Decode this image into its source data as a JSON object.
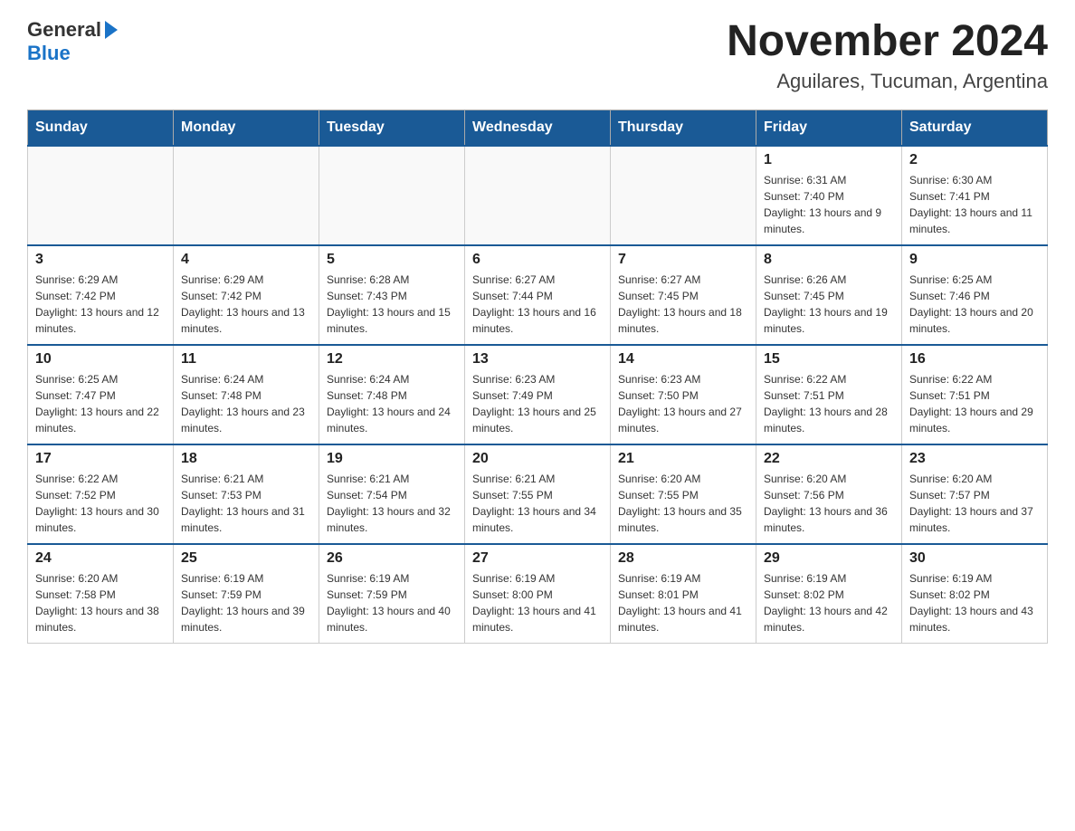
{
  "header": {
    "logo_text": "General",
    "logo_blue": "Blue",
    "title": "November 2024",
    "subtitle": "Aguilares, Tucuman, Argentina"
  },
  "days_of_week": [
    "Sunday",
    "Monday",
    "Tuesday",
    "Wednesday",
    "Thursday",
    "Friday",
    "Saturday"
  ],
  "weeks": [
    {
      "days": [
        {
          "num": "",
          "info": ""
        },
        {
          "num": "",
          "info": ""
        },
        {
          "num": "",
          "info": ""
        },
        {
          "num": "",
          "info": ""
        },
        {
          "num": "",
          "info": ""
        },
        {
          "num": "1",
          "info": "Sunrise: 6:31 AM\nSunset: 7:40 PM\nDaylight: 13 hours and 9 minutes."
        },
        {
          "num": "2",
          "info": "Sunrise: 6:30 AM\nSunset: 7:41 PM\nDaylight: 13 hours and 11 minutes."
        }
      ]
    },
    {
      "days": [
        {
          "num": "3",
          "info": "Sunrise: 6:29 AM\nSunset: 7:42 PM\nDaylight: 13 hours and 12 minutes."
        },
        {
          "num": "4",
          "info": "Sunrise: 6:29 AM\nSunset: 7:42 PM\nDaylight: 13 hours and 13 minutes."
        },
        {
          "num": "5",
          "info": "Sunrise: 6:28 AM\nSunset: 7:43 PM\nDaylight: 13 hours and 15 minutes."
        },
        {
          "num": "6",
          "info": "Sunrise: 6:27 AM\nSunset: 7:44 PM\nDaylight: 13 hours and 16 minutes."
        },
        {
          "num": "7",
          "info": "Sunrise: 6:27 AM\nSunset: 7:45 PM\nDaylight: 13 hours and 18 minutes."
        },
        {
          "num": "8",
          "info": "Sunrise: 6:26 AM\nSunset: 7:45 PM\nDaylight: 13 hours and 19 minutes."
        },
        {
          "num": "9",
          "info": "Sunrise: 6:25 AM\nSunset: 7:46 PM\nDaylight: 13 hours and 20 minutes."
        }
      ]
    },
    {
      "days": [
        {
          "num": "10",
          "info": "Sunrise: 6:25 AM\nSunset: 7:47 PM\nDaylight: 13 hours and 22 minutes."
        },
        {
          "num": "11",
          "info": "Sunrise: 6:24 AM\nSunset: 7:48 PM\nDaylight: 13 hours and 23 minutes."
        },
        {
          "num": "12",
          "info": "Sunrise: 6:24 AM\nSunset: 7:48 PM\nDaylight: 13 hours and 24 minutes."
        },
        {
          "num": "13",
          "info": "Sunrise: 6:23 AM\nSunset: 7:49 PM\nDaylight: 13 hours and 25 minutes."
        },
        {
          "num": "14",
          "info": "Sunrise: 6:23 AM\nSunset: 7:50 PM\nDaylight: 13 hours and 27 minutes."
        },
        {
          "num": "15",
          "info": "Sunrise: 6:22 AM\nSunset: 7:51 PM\nDaylight: 13 hours and 28 minutes."
        },
        {
          "num": "16",
          "info": "Sunrise: 6:22 AM\nSunset: 7:51 PM\nDaylight: 13 hours and 29 minutes."
        }
      ]
    },
    {
      "days": [
        {
          "num": "17",
          "info": "Sunrise: 6:22 AM\nSunset: 7:52 PM\nDaylight: 13 hours and 30 minutes."
        },
        {
          "num": "18",
          "info": "Sunrise: 6:21 AM\nSunset: 7:53 PM\nDaylight: 13 hours and 31 minutes."
        },
        {
          "num": "19",
          "info": "Sunrise: 6:21 AM\nSunset: 7:54 PM\nDaylight: 13 hours and 32 minutes."
        },
        {
          "num": "20",
          "info": "Sunrise: 6:21 AM\nSunset: 7:55 PM\nDaylight: 13 hours and 34 minutes."
        },
        {
          "num": "21",
          "info": "Sunrise: 6:20 AM\nSunset: 7:55 PM\nDaylight: 13 hours and 35 minutes."
        },
        {
          "num": "22",
          "info": "Sunrise: 6:20 AM\nSunset: 7:56 PM\nDaylight: 13 hours and 36 minutes."
        },
        {
          "num": "23",
          "info": "Sunrise: 6:20 AM\nSunset: 7:57 PM\nDaylight: 13 hours and 37 minutes."
        }
      ]
    },
    {
      "days": [
        {
          "num": "24",
          "info": "Sunrise: 6:20 AM\nSunset: 7:58 PM\nDaylight: 13 hours and 38 minutes."
        },
        {
          "num": "25",
          "info": "Sunrise: 6:19 AM\nSunset: 7:59 PM\nDaylight: 13 hours and 39 minutes."
        },
        {
          "num": "26",
          "info": "Sunrise: 6:19 AM\nSunset: 7:59 PM\nDaylight: 13 hours and 40 minutes."
        },
        {
          "num": "27",
          "info": "Sunrise: 6:19 AM\nSunset: 8:00 PM\nDaylight: 13 hours and 41 minutes."
        },
        {
          "num": "28",
          "info": "Sunrise: 6:19 AM\nSunset: 8:01 PM\nDaylight: 13 hours and 41 minutes."
        },
        {
          "num": "29",
          "info": "Sunrise: 6:19 AM\nSunset: 8:02 PM\nDaylight: 13 hours and 42 minutes."
        },
        {
          "num": "30",
          "info": "Sunrise: 6:19 AM\nSunset: 8:02 PM\nDaylight: 13 hours and 43 minutes."
        }
      ]
    }
  ]
}
